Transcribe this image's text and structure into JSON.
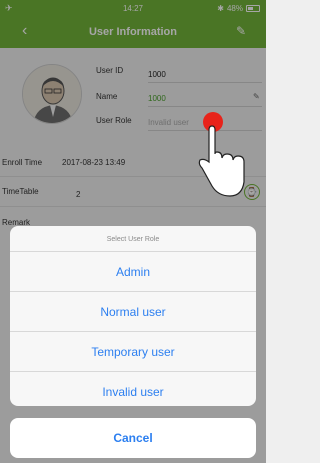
{
  "status": {
    "time": "14:27",
    "battery": "48%"
  },
  "nav": {
    "title": "User Information"
  },
  "profile": {
    "user_id_label": "User ID",
    "user_id_value": "1000",
    "name_label": "Name",
    "name_value": "1000",
    "role_label": "User Role",
    "role_value": "Invalid user"
  },
  "details": {
    "enroll_label": "Enroll Time",
    "enroll_value": "2017-08-23 13:49",
    "timetable_label": "TimeTable",
    "timetable_value": "2",
    "remark_label": "Remark"
  },
  "sheet": {
    "title": "Select User Role",
    "options": [
      "Admin",
      "Normal user",
      "Temporary user",
      "Invalid user"
    ],
    "cancel": "Cancel"
  },
  "colors": {
    "accent": "#72b43a",
    "action": "#2c7ff0",
    "name_value": "#4aa02c"
  }
}
